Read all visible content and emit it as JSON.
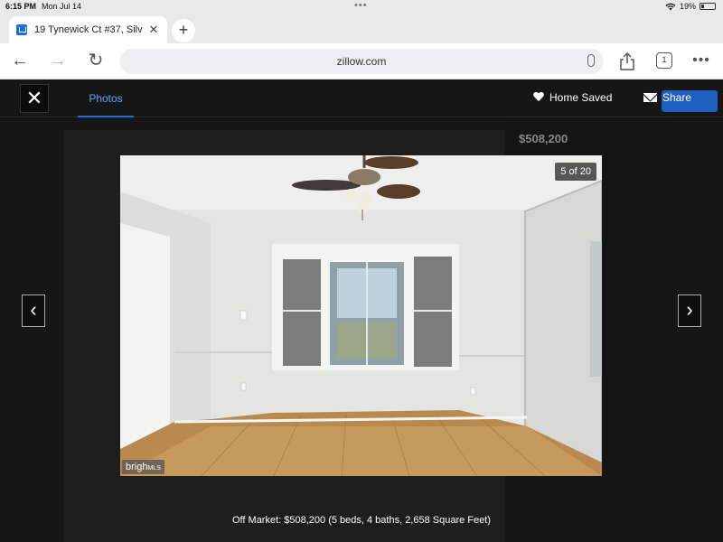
{
  "status_bar": {
    "time": "6:15 PM",
    "date": "Mon Jul 14",
    "battery": "19%",
    "wifi_icon": "wifi-icon",
    "battery_icon": "battery-charging-icon"
  },
  "browser": {
    "tab_title": "19 Tynewick Ct #37, Silv",
    "url": "zillow.com",
    "tab_count": "1",
    "icons": {
      "back": "arrow-left-icon",
      "forward": "arrow-right-icon",
      "reload": "reload-icon",
      "share": "share-icon",
      "menu": "more-icon",
      "new_tab": "plus-icon",
      "mic": "microphone-icon"
    }
  },
  "listing_viewer": {
    "photos_tab": "Photos",
    "home_saved": "Home Saved",
    "share": "Share",
    "background_price": "$508,200",
    "photo_counter": "5 of 20",
    "watermark_main": "brigh",
    "watermark_small": "MLS",
    "caption": "Off Market: $508,200 (5 beds, 4 baths, 2,658 Square Feet)"
  },
  "colors": {
    "accent_blue": "#1f6de0",
    "tab_text_blue": "#5fa3ff",
    "viewer_bg": "#161616"
  }
}
